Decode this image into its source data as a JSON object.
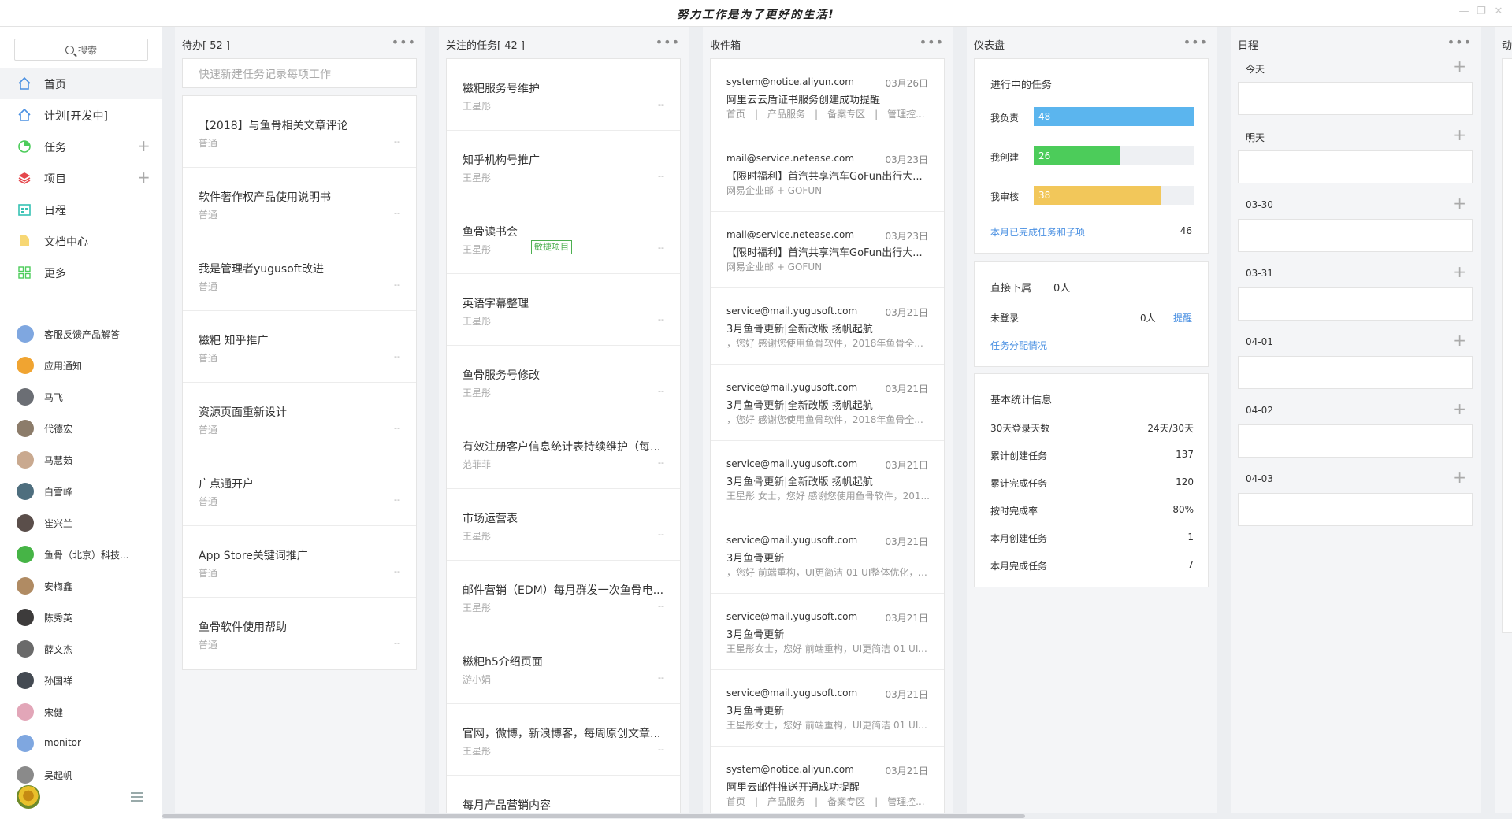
{
  "window": {
    "title": "努力工作是为了更好的生活!"
  },
  "sidebar": {
    "search_label": "搜索",
    "nav": [
      {
        "label": "首页",
        "icon": "home-icon",
        "plus": false
      },
      {
        "label": "计划[开发中]",
        "icon": "plan-icon",
        "plus": false
      },
      {
        "label": "任务",
        "icon": "pie-task-icon",
        "plus": true
      },
      {
        "label": "项目",
        "icon": "layers-icon",
        "plus": true
      },
      {
        "label": "日程",
        "icon": "calendar-icon",
        "plus": false
      },
      {
        "label": "文档中心",
        "icon": "folder-icon",
        "plus": false
      },
      {
        "label": "更多",
        "icon": "grid-icon",
        "plus": false
      }
    ],
    "contacts": [
      {
        "name": "客服反馈产品解答",
        "color": "#7fa7e0"
      },
      {
        "name": "应用通知",
        "color": "#f0a431"
      },
      {
        "name": "马飞",
        "color": "#6b6e74"
      },
      {
        "name": "代德宏",
        "color": "#8c7c6a"
      },
      {
        "name": "马慧茹",
        "color": "#c9a98f"
      },
      {
        "name": "白雪峰",
        "color": "#4e6e7e"
      },
      {
        "name": "崔兴兰",
        "color": "#5a4e4a"
      },
      {
        "name": "鱼骨（北京）科技...",
        "color": "#46b446"
      },
      {
        "name": "安梅鑫",
        "color": "#b08b63"
      },
      {
        "name": "陈秀英",
        "color": "#3d3b3b"
      },
      {
        "name": "薛文杰",
        "color": "#6a6a6a"
      },
      {
        "name": "孙国祥",
        "color": "#444a52"
      },
      {
        "name": "宋健",
        "color": "#e2a6b8"
      },
      {
        "name": "monitor",
        "color": "#7fa7e0"
      },
      {
        "name": "吴起帆",
        "color": "#8a8a8a"
      }
    ]
  },
  "todo": {
    "title": "待办[ 52 ]",
    "quickadd_placeholder": "快速新建任务记录每项工作",
    "items": [
      {
        "title": "【2018】与鱼骨相关文章评论",
        "sub": "普通",
        "due": "--"
      },
      {
        "title": "软件著作权产品使用说明书",
        "sub": "普通",
        "due": "--"
      },
      {
        "title": "我是管理者yugusoft改进",
        "sub": "普通",
        "due": "--"
      },
      {
        "title": "糍粑 知乎推广",
        "sub": "普通",
        "due": "--"
      },
      {
        "title": "资源页面重新设计",
        "sub": "普通",
        "due": "--"
      },
      {
        "title": "广点通开户",
        "sub": "普通",
        "due": "--"
      },
      {
        "title": "App Store关键词推广",
        "sub": "普通",
        "due": "--"
      },
      {
        "title": "鱼骨软件使用帮助",
        "sub": "普通",
        "due": "--"
      }
    ]
  },
  "followed": {
    "title": "关注的任务[ 42 ]",
    "items": [
      {
        "title": "糍粑服务号维护",
        "sub": "王星彤",
        "due": "--",
        "tag": ""
      },
      {
        "title": "知乎机构号推广",
        "sub": "王星彤",
        "due": "--",
        "tag": ""
      },
      {
        "title": "鱼骨读书会",
        "sub": "王星彤",
        "due": "--",
        "tag": "敏捷项目"
      },
      {
        "title": "英语字幕整理",
        "sub": "王星彤",
        "due": "--",
        "tag": ""
      },
      {
        "title": "鱼骨服务号修改",
        "sub": "王星彤",
        "due": "--",
        "tag": ""
      },
      {
        "title": "有效注册客户信息统计表持续维护（每...",
        "sub": "范菲菲",
        "due": "--",
        "tag": ""
      },
      {
        "title": "市场运营表",
        "sub": "王星彤",
        "due": "--",
        "tag": ""
      },
      {
        "title": "邮件营销（EDM）每月群发一次鱼骨电...",
        "sub": "王星彤",
        "due": "--",
        "tag": ""
      },
      {
        "title": "糍粑h5介绍页面",
        "sub": "游小娟",
        "due": "--",
        "tag": ""
      },
      {
        "title": "官网，微博，新浪博客，每周原创文章...",
        "sub": "王星彤",
        "due": "--",
        "tag": ""
      },
      {
        "title": "每月产品营销内容",
        "sub": "",
        "due": "",
        "tag": ""
      }
    ]
  },
  "inbox": {
    "title": "收件箱",
    "items": [
      {
        "from": "system@notice.aliyun.com",
        "date": "03月26日",
        "subject": "阿里云云盾证书服务创建成功提醒",
        "preview": "首页　|　产品服务　|　备案专区　|　管理控..."
      },
      {
        "from": "mail@service.netease.com",
        "date": "03月23日",
        "subject": "【限时福利】首汽共享汽车GoFun出行大...",
        "preview": "网易企业邮 + GOFUN"
      },
      {
        "from": "mail@service.netease.com",
        "date": "03月23日",
        "subject": "【限时福利】首汽共享汽车GoFun出行大...",
        "preview": "网易企业邮 + GOFUN"
      },
      {
        "from": "service@mail.yugusoft.com",
        "date": "03月21日",
        "subject": "3月鱼骨更新|全新改版 扬帆起航",
        "preview": "，您好 感谢您使用鱼骨软件，2018年鱼骨全..."
      },
      {
        "from": "service@mail.yugusoft.com",
        "date": "03月21日",
        "subject": "3月鱼骨更新|全新改版 扬帆起航",
        "preview": "，您好 感谢您使用鱼骨软件，2018年鱼骨全..."
      },
      {
        "from": "service@mail.yugusoft.com",
        "date": "03月21日",
        "subject": "3月鱼骨更新|全新改版 扬帆起航",
        "preview": "王星彤 女士，您好 感谢您使用鱼骨软件，201..."
      },
      {
        "from": "service@mail.yugusoft.com",
        "date": "03月21日",
        "subject": "3月鱼骨更新",
        "preview": "，您好 前端重构，UI更简洁 01 UI整体优化，..."
      },
      {
        "from": "service@mail.yugusoft.com",
        "date": "03月21日",
        "subject": "3月鱼骨更新",
        "preview": "王星彤女士，您好 前端重构，UI更简洁 01 UI..."
      },
      {
        "from": "service@mail.yugusoft.com",
        "date": "03月21日",
        "subject": "3月鱼骨更新",
        "preview": "王星彤女士，您好 前端重构，UI更简洁 01 UI..."
      },
      {
        "from": "system@notice.aliyun.com",
        "date": "03月21日",
        "subject": "阿里云邮件推送开通成功提醒",
        "preview": "首页　|　产品服务　|　备案专区　|　管理控..."
      }
    ]
  },
  "dashboard": {
    "title": "仪表盘",
    "progress": {
      "heading": "进行中的任务",
      "max": 48,
      "bars": [
        {
          "label": "我负责",
          "value": 48,
          "color": "#5bb5ee"
        },
        {
          "label": "我创建",
          "value": 26,
          "color": "#4ccc5a"
        },
        {
          "label": "我审核",
          "value": 38,
          "color": "#f2c75a"
        }
      ],
      "completed_label": "本月已完成任务和子项",
      "completed_value": "46"
    },
    "subordinates": {
      "heading": "直接下属",
      "count": "0人",
      "not_logged_label": "未登录",
      "not_logged_value": "0人",
      "remind": "提醒",
      "assign_link": "任务分配情况"
    },
    "stats": {
      "heading": "基本统计信息",
      "rows": [
        {
          "label": "30天登录天数",
          "value": "24天/30天"
        },
        {
          "label": "累计创建任务",
          "value": "137"
        },
        {
          "label": "累计完成任务",
          "value": "120"
        },
        {
          "label": "按时完成率",
          "value": "80%"
        },
        {
          "label": "本月创建任务",
          "value": "1"
        },
        {
          "label": "本月完成任务",
          "value": "7"
        }
      ]
    }
  },
  "schedule": {
    "title": "日程",
    "days": [
      "今天",
      "明天",
      "03-30",
      "03-31",
      "04-01",
      "04-02",
      "04-03"
    ]
  },
  "next_column": {
    "title_partial": "动"
  }
}
